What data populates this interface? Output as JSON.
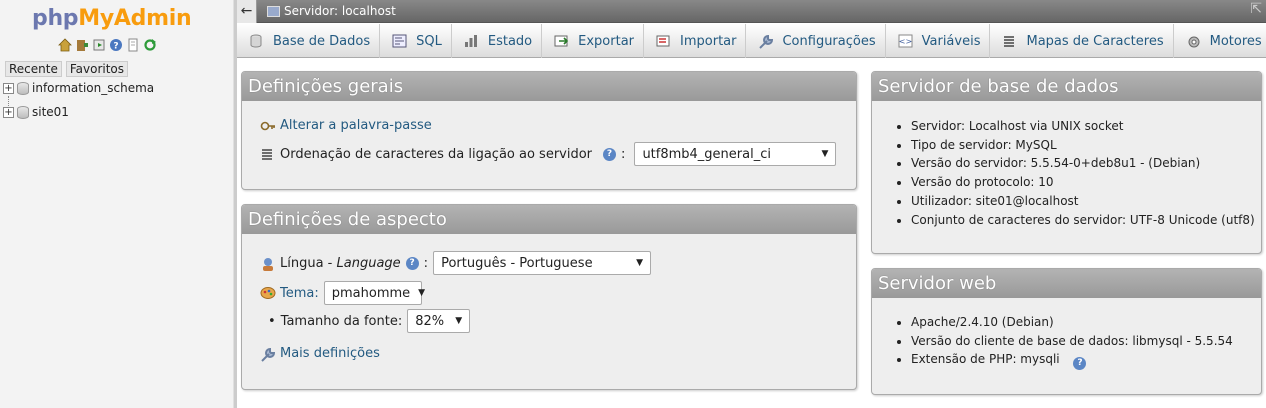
{
  "nav": {
    "logo_php": "php",
    "logo_myadmin": "MyAdmin",
    "icons": [
      "home-icon",
      "exit-icon",
      "query-window-icon",
      "docs-icon",
      "documentation-icon",
      "reload-icon"
    ],
    "tabs": [
      "Recente",
      "Favoritos"
    ],
    "databases": [
      {
        "name": "information_schema"
      },
      {
        "name": "site01"
      }
    ]
  },
  "topbar": {
    "back": "←",
    "server_label": "Servidor: localhost",
    "collapse": "⇱"
  },
  "menu": [
    {
      "label": "Base de Dados",
      "icon": "database-icon"
    },
    {
      "label": "SQL",
      "icon": "sql-icon"
    },
    {
      "label": "Estado",
      "icon": "status-icon"
    },
    {
      "label": "Exportar",
      "icon": "export-icon"
    },
    {
      "label": "Importar",
      "icon": "import-icon"
    },
    {
      "label": "Configurações",
      "icon": "wrench-icon"
    },
    {
      "label": "Variáveis",
      "icon": "variables-icon"
    },
    {
      "label": "Mapas de Caracteres",
      "icon": "charset-icon"
    },
    {
      "label": "Motores",
      "icon": "engines-icon"
    }
  ],
  "general": {
    "title": "Definições gerais",
    "change_password": "Alterar a palavra-passe",
    "collation_label": "Ordenação de caracteres da ligação ao servidor",
    "collation_value": "utf8mb4_general_ci"
  },
  "appearance": {
    "title": "Definições de aspecto",
    "language_label": "Língua - ",
    "language_italic": "Language",
    "language_value": "Português - Portuguese",
    "theme_label": "Tema:",
    "theme_value": "pmahomme",
    "fontsize_label": "Tamanho da fonte:",
    "fontsize_value": "82%",
    "more_settings": "Mais definições"
  },
  "db_server": {
    "title": "Servidor de base de dados",
    "items": [
      "Servidor: Localhost via UNIX socket",
      "Tipo de servidor: MySQL",
      "Versão do servidor: 5.5.54-0+deb8u1 - (Debian)",
      "Versão do protocolo: 10",
      "Utilizador: site01@localhost",
      "Conjunto de caracteres do servidor: UTF-8 Unicode (utf8)"
    ]
  },
  "web_server": {
    "title": "Servidor web",
    "items": [
      "Apache/2.4.10 (Debian)",
      "Versão do cliente de base de dados: libmysql - 5.5.54",
      "Extensão de PHP: mysqli"
    ]
  },
  "colors": {
    "link": "#235a81",
    "logo_php": "#6c78af",
    "logo_myadmin": "#f89c0e",
    "panel_header": "#a6a6a6"
  }
}
